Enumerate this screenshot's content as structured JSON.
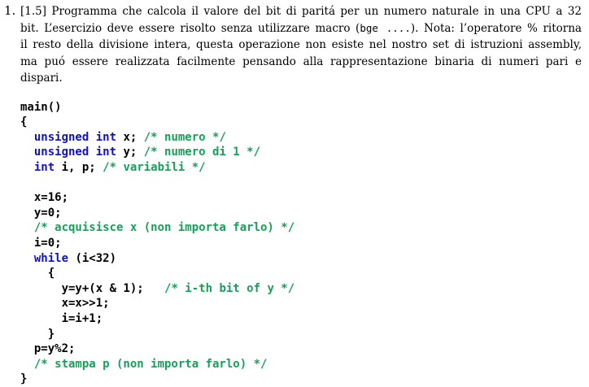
{
  "exercise": {
    "number": "1.",
    "text_lines": [
      "[1.5] Programma che calcola il valore del bit di paritá per un numero naturale in una CPU a 32",
      "bit. L’esercizio deve essere risolto senza utilizzare macro (",
      "il resto della divisione intera, questa operazione non esiste nel nostro set di istruzioni assembly,",
      "ma puó essere realizzata facilmente pensando alla rappresentazione binaria di numeri pari e",
      "dispari."
    ],
    "inline_code": "bge ....",
    "line2_suffix": "). Nota: l’operatore % ritorna"
  },
  "code": {
    "main": "main()",
    "open_brace": "{",
    "decl_x_kw": "unsigned int",
    "decl_x_rest": " x; ",
    "decl_x_comment": "/* numero */",
    "decl_y_kw": "unsigned int",
    "decl_y_rest": " y; ",
    "decl_y_comment": "/* numero di 1 */",
    "decl_ip_kw": "int",
    "decl_ip_rest": " i, p; ",
    "decl_ip_comment": "/* variabili */",
    "assign_x": "x=16;",
    "assign_y": "y=0;",
    "comment_acq": "/* acquisisce x (non importa farlo) */",
    "assign_i": "i=0;",
    "while_kw": "while",
    "while_cond": " (i<32)",
    "loop_open": "{",
    "loop_stmt1": "y=y+(x & 1);   ",
    "loop_stmt1_comment": "/* i-th bit of y */",
    "loop_stmt2": "x=x>>1;",
    "loop_stmt3": "i=i+1;",
    "loop_close": "}",
    "assign_p": "p=y%2;",
    "comment_print": "/* stampa p (non importa farlo) */",
    "close_brace": "}"
  },
  "colors": {
    "keyword": "#1010c8",
    "comment": "#16a05a",
    "text": "#000000"
  }
}
